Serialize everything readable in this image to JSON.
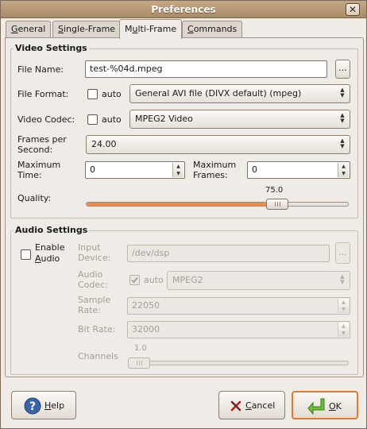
{
  "window": {
    "title": "Preferences",
    "close_glyph": "✕"
  },
  "tabs": [
    {
      "label": "General",
      "mnemonic": "G",
      "rest": "eneral"
    },
    {
      "label": "Single-Frame",
      "mnemonic": "S",
      "rest": "ingle-Frame"
    },
    {
      "label": "Multi-Frame",
      "pre": "M",
      "mnemonic": "u",
      "rest": "lti-Frame"
    },
    {
      "label": "Commands",
      "mnemonic": "C",
      "rest": "ommands"
    }
  ],
  "video": {
    "section_title": "Video Settings",
    "file_name_label": "File Name:",
    "file_name_value": "test-%04d.mpeg",
    "browse_label": "...",
    "file_format_label": "File Format:",
    "file_format_auto": "auto",
    "file_format_value": "General AVI file (DIVX default) (mpeg)",
    "codec_label": "Video Codec:",
    "codec_auto": "auto",
    "codec_value": "MPEG2 Video",
    "fps_label_1": "Frames per",
    "fps_label_2": "Second:",
    "fps_value": "24.00",
    "max_time_label_1": "Maximum",
    "max_time_label_2": "Time:",
    "max_time_value": "0",
    "max_frames_label_1": "Maximum",
    "max_frames_label_2": "Frames:",
    "max_frames_value": "0",
    "quality_label": "Quality:",
    "quality_value": "75.0",
    "quality_fraction": 0.75
  },
  "audio": {
    "section_title": "Audio Settings",
    "enable_label_1": "Enable",
    "enable_label_2": "Audio",
    "enable_mnemonic": "A",
    "enable_rest": "udio",
    "input_device_label_1": "Input",
    "input_device_label_2": "Device:",
    "input_device_value": "/dev/dsp",
    "browse_label": "...",
    "codec_label_1": "Audio",
    "codec_label_2": "Codec:",
    "codec_auto": "auto",
    "codec_value": "MPEG2",
    "sample_rate_label_1": "Sample",
    "sample_rate_label_2": "Rate:",
    "sample_rate_value": "22050",
    "bit_rate_label": "Bit Rate:",
    "bit_rate_value": "32000",
    "channels_label": "Channels",
    "channels_value": "1.0",
    "channels_fraction": 0.0
  },
  "buttons": {
    "help": {
      "mnemonic": "H",
      "rest": "elp",
      "icon": "help-icon"
    },
    "cancel": {
      "mnemonic": "C",
      "rest": "ancel",
      "icon": "cancel-icon"
    },
    "ok": {
      "mnemonic": "O",
      "rest": "K",
      "icon": "ok-arrow-icon"
    }
  },
  "colors": {
    "accent": "#f08a4b",
    "titlebar": "#b0906e",
    "default_border": "#e07b2e"
  }
}
